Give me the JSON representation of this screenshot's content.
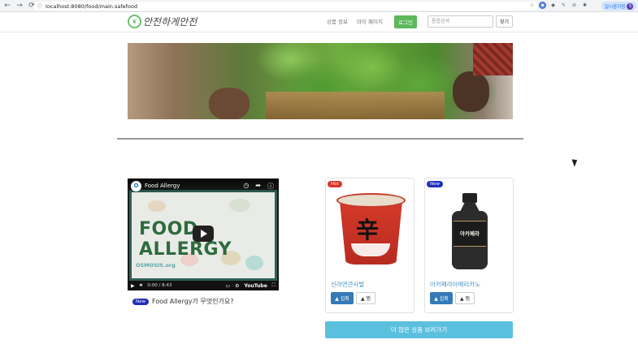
{
  "browser": {
    "url": "localhost:8080/food/main.safefood",
    "pause_label": "일시중지됨",
    "profile_initial": "S"
  },
  "header": {
    "logo_text": "안전하게안전",
    "nav_items": [
      "상품 정보",
      "마이 페이지"
    ],
    "login_label": "로그인",
    "search_placeholder": "통합검색",
    "search_button": "찾기"
  },
  "video": {
    "channel": "O",
    "title": "Food Allergy",
    "big_text": "FOOD ALLERGY",
    "brand": "OSMOSIS.org",
    "time": "0:00 / 8:43",
    "platform": "YouTube",
    "caption_badge": "New",
    "caption": "Food Allergy가 무엇인가요?"
  },
  "products": [
    {
      "tag": "Hot",
      "name": "신라면큰사발",
      "up_label": "▲ 섭취",
      "pick_label": "▲ 찜",
      "glyph": "辛"
    },
    {
      "tag": "New",
      "name": "아카페라아메리카노",
      "up_label": "▲ 섭취",
      "pick_label": "▲ 찜",
      "bottle_label": "아카페라"
    }
  ],
  "more_button": "더 많은 상품 보러가기",
  "colors": {
    "login_green": "#5cb85c",
    "primary_blue": "#337ab7",
    "info_cyan": "#5bc0de",
    "badge_new": "#1f2fb8",
    "badge_hot": "#d9342b"
  }
}
